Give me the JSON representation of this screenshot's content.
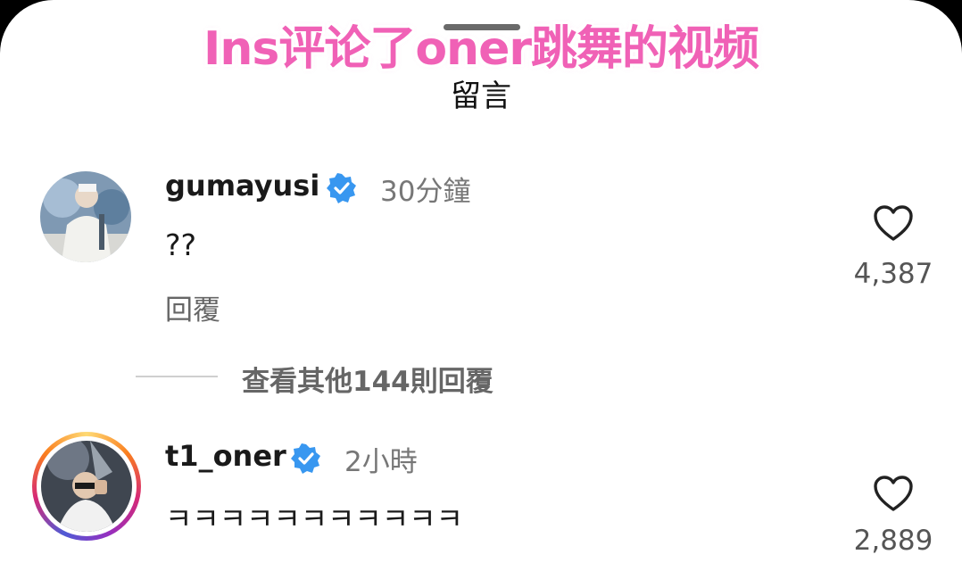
{
  "overlay": {
    "title": "Ins评论了oner跳舞的视频",
    "color": "#f061b6"
  },
  "sheet": {
    "title": "留言"
  },
  "comments": [
    {
      "username": "gumayusi",
      "verified": true,
      "time": "30分鐘",
      "text": "??",
      "reply_label": "回覆",
      "likes": "4,387",
      "icons": [
        "avatar",
        "verified-badge-icon",
        "heart-icon"
      ]
    },
    {
      "username": "t1_oner",
      "verified": true,
      "time": "2小時",
      "text": "ㅋㅋㅋㅋㅋㅋㅋㅋㅋㅋㅋ",
      "likes": "2,889",
      "story_ring": true,
      "icons": [
        "avatar",
        "verified-badge-icon",
        "heart-icon"
      ]
    }
  ],
  "view_replies": {
    "label": "查看其他144則回覆"
  },
  "colors": {
    "verified": "#3897f0",
    "text": "#1a1a1a",
    "secondary": "#777777"
  }
}
